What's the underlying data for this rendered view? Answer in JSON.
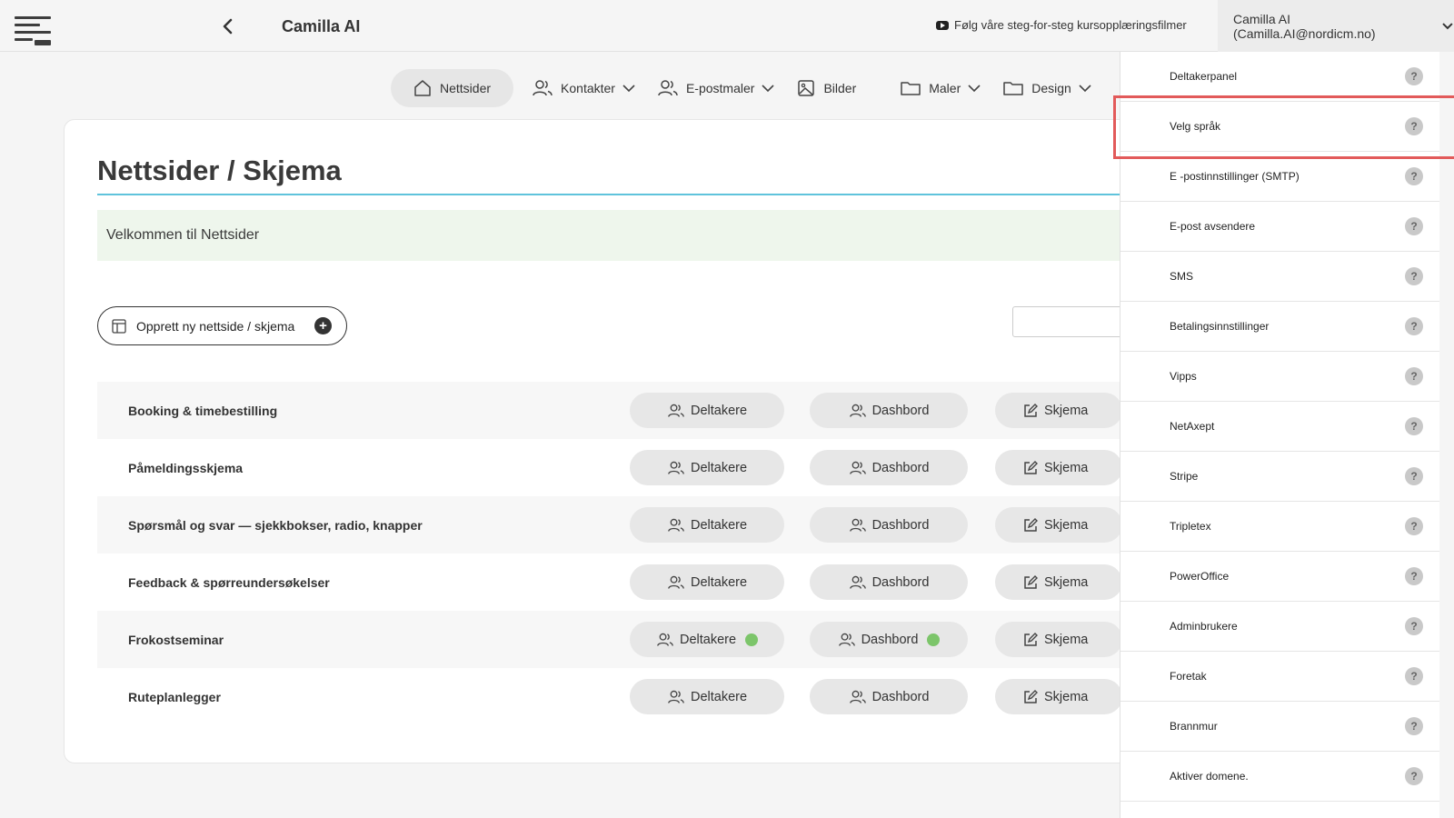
{
  "header": {
    "app_title": "Camilla AI",
    "tutorial_link": "Følg våre steg-for-steg kursopplæringsfilmer",
    "user_label": "Camilla AI (Camilla.AI@nordicm.no)"
  },
  "nav": {
    "items": [
      {
        "label": "Nettsider",
        "icon": "home-icon"
      },
      {
        "label": "Kontakter",
        "icon": "users-icon"
      },
      {
        "label": "E-postmaler",
        "icon": "users-icon"
      },
      {
        "label": "Bilder",
        "icon": "image-icon"
      },
      {
        "label": "Maler",
        "icon": "folder-icon"
      },
      {
        "label": "Design",
        "icon": "folder-icon"
      }
    ]
  },
  "main": {
    "title": "Nettsider / Skjema",
    "welcome": "Velkommen til Nettsider",
    "create_button": "Opprett ny nettside / skjema",
    "search_placeholder": "",
    "rows": [
      {
        "name": "Booking & timebestilling",
        "deltakere": "Deltakere",
        "dashbord": "Dashbord",
        "skjema": "Skjema"
      },
      {
        "name": "Påmeldingsskjema",
        "deltakere": "Deltakere",
        "dashbord": "Dashbord",
        "skjema": "Skjema"
      },
      {
        "name": "Spørsmål og svar — sjekkbokser, radio, knapper",
        "deltakere": "Deltakere",
        "dashbord": "Dashbord",
        "skjema": "Skjema"
      },
      {
        "name": "Feedback & spørreundersøkelser",
        "deltakere": "Deltakere",
        "dashbord": "Dashbord",
        "skjema": "Skjema"
      },
      {
        "name": "Frokostseminar",
        "deltakere": "Deltakere",
        "dashbord": "Dashbord",
        "skjema": "Skjema"
      },
      {
        "name": "Ruteplanlegger",
        "deltakere": "Deltakere",
        "dashbord": "Dashbord",
        "skjema": "Skjema"
      }
    ]
  },
  "dropdown": {
    "items": [
      "Deltakerpanel",
      "Velg språk",
      "E -postinnstillinger (SMTP)",
      "E-post avsendere",
      "SMS",
      "Betalingsinnstillinger",
      "Vipps",
      "NetAxept",
      "Stripe",
      "Tripletex",
      "PowerOffice",
      "Adminbrukere",
      "Foretak",
      "Brannmur",
      "Aktiver domene."
    ],
    "help_glyph": "?"
  },
  "colors": {
    "accent_rule": "#5fc3dc",
    "status_dot": "#7cc56a",
    "highlight": "#e25a5a"
  }
}
